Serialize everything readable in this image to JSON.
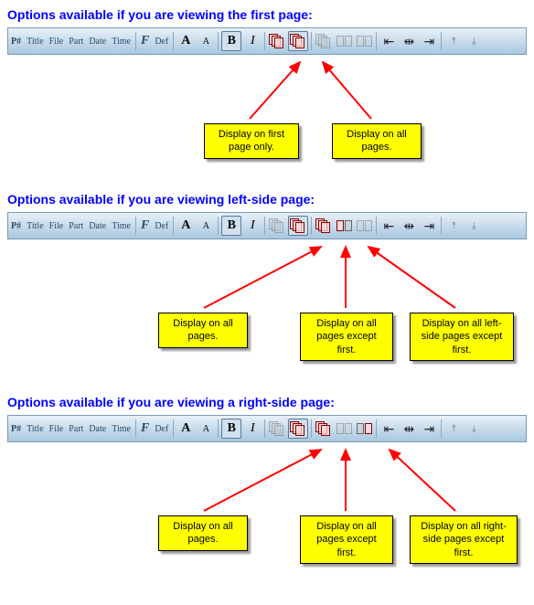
{
  "sections": [
    {
      "title": "Options available if you are viewing the first page:",
      "callouts": [
        {
          "text": "Display on first page only."
        },
        {
          "text": "Display on all pages."
        }
      ]
    },
    {
      "title": "Options available if you are viewing left-side page:",
      "callouts": [
        {
          "text": "Display on all pages."
        },
        {
          "text": "Display on all pages except first."
        },
        {
          "text": "Display on all left-side pages except first."
        }
      ]
    },
    {
      "title": "Options available if you are viewing a right-side page:",
      "callouts": [
        {
          "text": "Display on all pages."
        },
        {
          "text": "Display on all pages except first."
        },
        {
          "text": "Display on all right-side pages except first."
        }
      ]
    }
  ],
  "toolbar": {
    "pnum": "P#",
    "title": "Title",
    "file": "File",
    "part": "Part",
    "date": "Date",
    "time": "Time",
    "def": "Def",
    "bigA": "A",
    "smallA": "A",
    "B": "B",
    "I": "I"
  }
}
